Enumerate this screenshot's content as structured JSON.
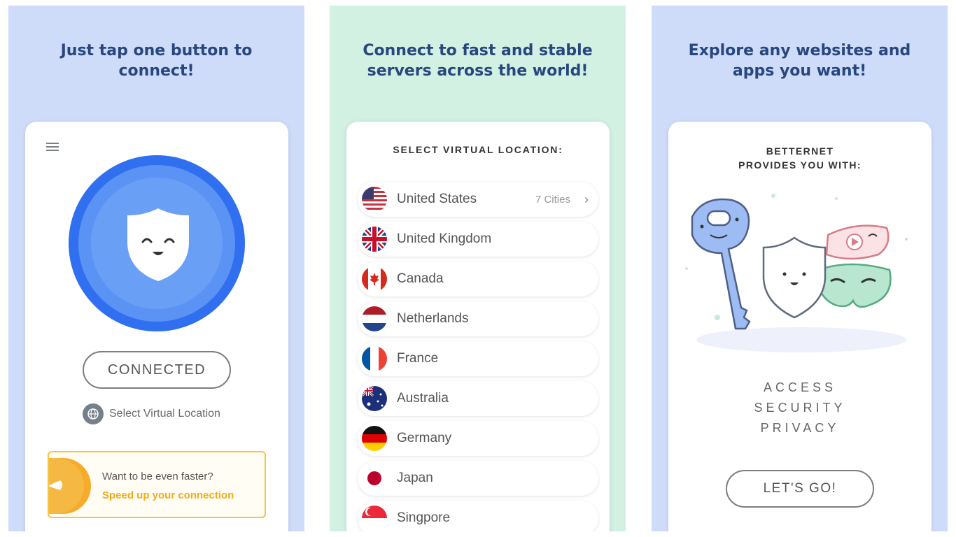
{
  "panels": {
    "one": {
      "heading": "Just tap one button to connect!",
      "status_button": "CONNECTED",
      "select_location_label": "Select Virtual Location",
      "promo": {
        "question": "Want to be even faster?",
        "cta": "Speed up your connection"
      }
    },
    "two": {
      "heading": "Connect to fast and stable servers across the world!",
      "card_title": "SELECT VIRTUAL LOCATION:",
      "countries": [
        {
          "name": "United States",
          "cities": "7 Cities"
        },
        {
          "name": "United Kingdom"
        },
        {
          "name": "Canada"
        },
        {
          "name": "Netherlands"
        },
        {
          "name": "France"
        },
        {
          "name": "Australia"
        },
        {
          "name": "Germany"
        },
        {
          "name": "Japan"
        },
        {
          "name": "Singpore"
        }
      ]
    },
    "three": {
      "heading": "Explore any websites and apps you want!",
      "card_title_line1": "BETTERNET",
      "card_title_line2": "PROVIDES YOU WITH:",
      "features": [
        "ACCESS",
        "SECURITY",
        "PRIVACY"
      ],
      "cta_button": "LET'S GO!"
    }
  },
  "icons": {
    "menu": "hamburger-icon",
    "shield": "shield-mascot-icon",
    "globe": "globe-icon",
    "rocket": "rocket-icon",
    "chevron": "chevron-right-icon"
  },
  "colors": {
    "panel_blue": "#cfdcf9",
    "panel_green": "#d2f1e3",
    "heading": "#27477e",
    "connect_ring": "#2f6ff0",
    "promo_accent": "#f2ad16"
  }
}
